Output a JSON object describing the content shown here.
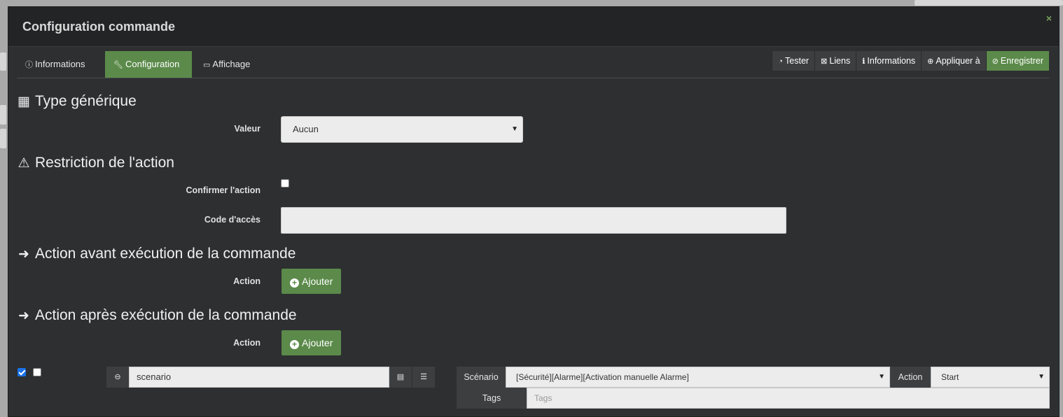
{
  "modal": {
    "title": "Configuration commande",
    "close": "×"
  },
  "tabs": [
    {
      "icon": "info-icon",
      "label": "Informations"
    },
    {
      "icon": "wrench-icon",
      "label": "Configuration"
    },
    {
      "icon": "desktop-icon",
      "label": "Affichage"
    }
  ],
  "toolbar": {
    "test": "Tester",
    "links": "Liens",
    "info": "Informations",
    "apply": "Appliquer à",
    "save": "Enregistrer"
  },
  "generic_type": {
    "title": "Type générique",
    "value_label": "Valeur",
    "value": "Aucun"
  },
  "restriction": {
    "title": "Restriction de l'action",
    "confirm_label": "Confirmer l'action",
    "code_label": "Code d'accès",
    "code_value": ""
  },
  "pre_action": {
    "title": "Action avant exécution de la commande",
    "action_label": "Action",
    "add_label": "Ajouter"
  },
  "post_action": {
    "title": "Action après exécution de la commande",
    "action_label": "Action",
    "add_label": "Ajouter",
    "row": {
      "enabled": true,
      "background": false,
      "command": "scenario",
      "scenario_label": "Scénario",
      "scenario_value": "[Sécurité][Alarme][Activation manuelle Alarme]",
      "action_label": "Action",
      "action_value": "Start",
      "tags_label": "Tags",
      "tags_placeholder": "Tags"
    }
  },
  "colors": {
    "accent": "#5b8a4a",
    "modal_bg": "#2d2f31",
    "header_bg": "#232425"
  }
}
